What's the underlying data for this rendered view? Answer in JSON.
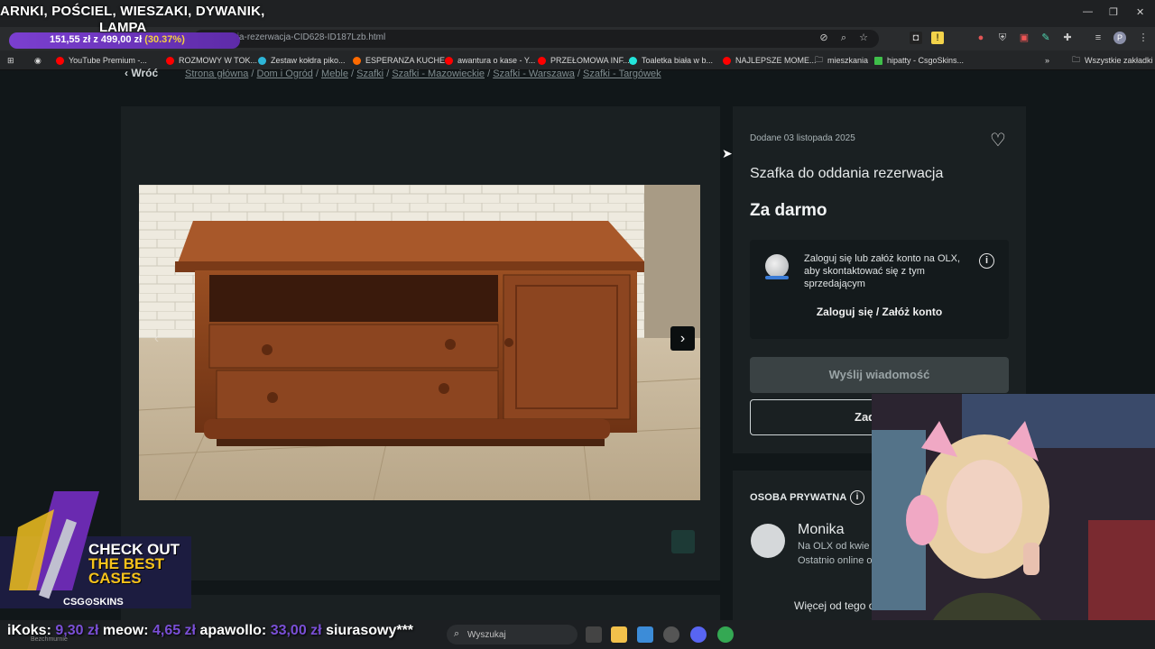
{
  "overlay": {
    "title_line1": "ARNKI, POŚCIEL, WIESZAKI, DYWANIK,",
    "title_line2": "LAMPA",
    "progress_current": "151,55 zł",
    "progress_of": "z",
    "progress_goal": "499,00 zł",
    "progress_percent": "(30.37%)"
  },
  "browser": {
    "url": "o-oddania-rezerwacja-CID628-ID187Lzb.html",
    "bookmarks": [
      {
        "label": "YouTube Premium -...",
        "color": "#ff0000"
      },
      {
        "label": "ROZMOWY W TOK...",
        "color": "#ff0000"
      },
      {
        "label": "Zestaw kołdra piko...",
        "color": "#2db5d8"
      },
      {
        "label": "ESPERANZA KUCHE...",
        "color": "#ff6a00"
      },
      {
        "label": "awantura o kase - Y...",
        "color": "#ff0000"
      },
      {
        "label": "PRZEŁOMOWA INF...",
        "color": "#ff0000"
      },
      {
        "label": "Toaletka biała w b...",
        "color": "#23e5db"
      },
      {
        "label": "NAJLEPSZE MOME...",
        "color": "#ff0000"
      },
      {
        "label": "mieszkania",
        "color": "#c8c8c8"
      },
      {
        "label": "hipatty - CsgoSkins...",
        "color": "#3fbf4a"
      }
    ],
    "all_bookmarks": "Wszystkie zakładki"
  },
  "page": {
    "back_label": "Wróć",
    "breadcrumb": [
      "Strona główna",
      "Dom i Ogród",
      "Meble",
      "Szafki",
      "Szafki - Mazowieckie",
      "Szafki - Warszawa",
      "Szafki - Targówek"
    ],
    "date": "Dodane 03 listopada 2025",
    "title": "Szafka do oddania rezerwacja",
    "price": "Za darmo",
    "login_prompt": "Zaloguj się lub załóż konto na OLX, aby skontaktować się z tym sprzedającym",
    "login_link": "Zaloguj się / Załóż konto",
    "message_button": "Wyślij wiadomość",
    "call_button": "Zad",
    "seller_type": "OSOBA PRYWATNA",
    "seller_name": "Monika",
    "seller_since": "Na OLX od kwie",
    "seller_online": "Ostatnio online o",
    "more_from": "Więcej od tego o"
  },
  "promo": {
    "line1": "CHECK OUT",
    "line2": "THE BEST",
    "line3": "CASES",
    "brand": "CSG⊙SKINS"
  },
  "ticker": {
    "d1_name": "iKoks:",
    "d1_amount": "9,30 zł",
    "d2_name": "meow:",
    "d2_amount": "4,65 zł",
    "d3_name": "apawollo:",
    "d3_amount": "33,00 zł",
    "d4_name": "siurasowy***",
    "sub": "Bezchmurnie"
  },
  "taskbar": {
    "search_placeholder": "Wyszukaj"
  }
}
